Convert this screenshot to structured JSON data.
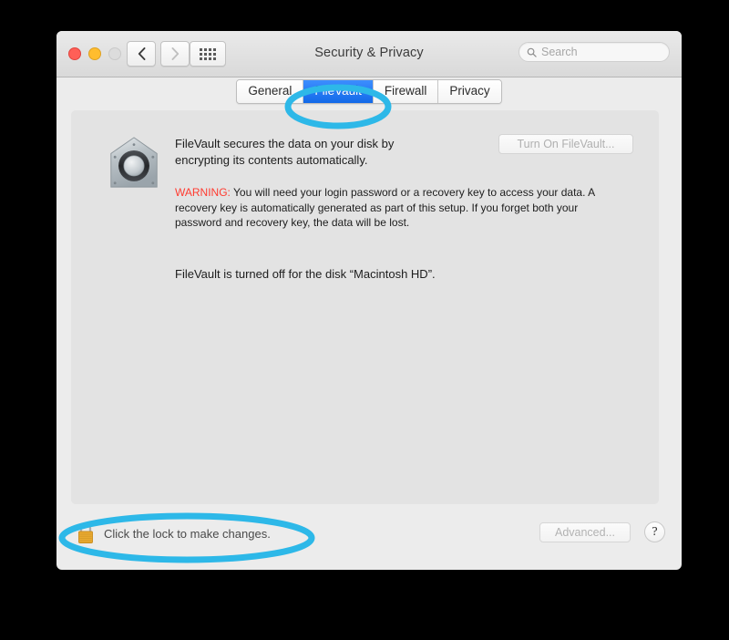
{
  "window": {
    "title": "Security & Privacy",
    "traffic_lights": [
      "close",
      "minimize",
      "zoom"
    ]
  },
  "toolbar": {
    "back_icon": "chevron-left-icon",
    "forward_icon": "chevron-right-icon",
    "show_all_icon": "grid-icon",
    "search": {
      "icon": "search-icon",
      "placeholder": "Search",
      "value": ""
    }
  },
  "tabs": [
    {
      "label": "General",
      "selected": false
    },
    {
      "label": "FileVault",
      "selected": true
    },
    {
      "label": "Firewall",
      "selected": false
    },
    {
      "label": "Privacy",
      "selected": false
    }
  ],
  "main": {
    "icon": "filevault-icon",
    "intro": "FileVault secures the data on your disk by encrypting its contents automatically.",
    "warning_label": "WARNING:",
    "warning_text": " You will need your login password or a recovery key to access your data. A recovery key is automatically generated as part of this setup. If you forget both your password and recovery key, the data will be lost.",
    "status": "FileVault is turned off for the disk “Macintosh HD”.",
    "turn_on_button": "Turn On FileVault..."
  },
  "footer": {
    "lock_icon": "lock-closed-icon",
    "lock_text": "Click the lock to make changes.",
    "advanced_button": "Advanced...",
    "help_button": "?"
  },
  "annotations": {
    "color": "#2DB8E8",
    "items": [
      {
        "target": "filevault-tab"
      },
      {
        "target": "lock-row"
      }
    ]
  },
  "colors": {
    "selected_tab": "#1269e8",
    "warning": "#ff3b30",
    "annotation": "#2DB8E8",
    "window_bg": "#ececec",
    "panel_bg": "#e3e3e3",
    "backdrop": "#000000"
  }
}
